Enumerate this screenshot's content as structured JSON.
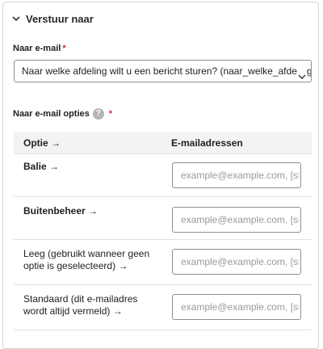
{
  "section": {
    "title": "Verstuur naar",
    "toggle_icon": "chevron-down-icon"
  },
  "email_field": {
    "label": "Naar e-mail",
    "required_marker": "*",
    "selected_value": "Naar welke afdeling wilt u een bericht sturen? (naar_welke_afdeling)"
  },
  "email_options": {
    "label": "Naar e-mail opties",
    "help_icon_glyph": "?",
    "required_marker": "*",
    "columns": [
      "Optie →",
      "E-mailadressen"
    ],
    "rows": [
      {
        "label": "Balie →",
        "bold": true,
        "placeholder": "example@example.com, [site:mail]"
      },
      {
        "label": "Buitenbeheer →",
        "bold": true,
        "placeholder": "example@example.com, [site:mail]"
      },
      {
        "label": "Leeg (gebruikt wanneer geen optie is geselecteerd) →",
        "bold": false,
        "placeholder": "example@example.com, [site:mail]"
      },
      {
        "label": "Standaard (dit e-mailadres wordt altijd vermeld) →",
        "bold": false,
        "placeholder": "example@example.com, [site:mail]"
      }
    ]
  },
  "colors": {
    "required": "#d42a2a",
    "header_bg": "#f3f3f6",
    "border": "#8e8e93"
  }
}
